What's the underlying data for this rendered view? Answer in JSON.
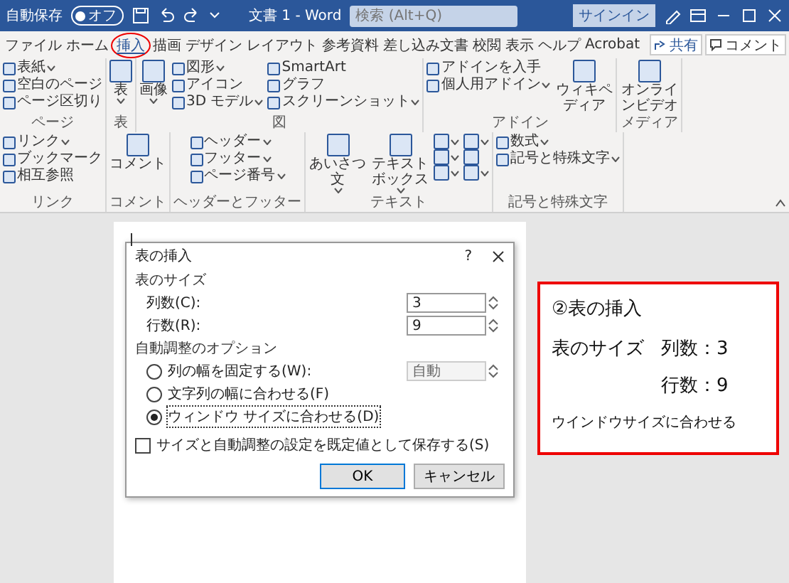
{
  "title_bar": {
    "autosave_label": "自動保存",
    "autosave_toggle": {
      "on": false,
      "label": "オフ"
    },
    "document_title": "文書 1 - Word",
    "search": {
      "placeholder": "検索 (Alt+Q)"
    },
    "sign_in": "サインイン"
  },
  "ribbon_tabs": [
    {
      "label": "ファイル",
      "selected": false,
      "circled": false
    },
    {
      "label": "ホーム",
      "selected": false,
      "circled": false
    },
    {
      "label": "挿入",
      "selected": true,
      "circled": true
    },
    {
      "label": "描画",
      "selected": false,
      "circled": false
    },
    {
      "label": "デザイン",
      "selected": false,
      "circled": false
    },
    {
      "label": "レイアウト",
      "selected": false,
      "circled": false
    },
    {
      "label": "参考資料",
      "selected": false,
      "circled": false
    },
    {
      "label": "差し込み文書",
      "selected": false,
      "circled": false
    },
    {
      "label": "校閲",
      "selected": false,
      "circled": false
    },
    {
      "label": "表示",
      "selected": false,
      "circled": false
    },
    {
      "label": "ヘルプ",
      "selected": false,
      "circled": false
    },
    {
      "label": "Acrobat",
      "selected": false,
      "circled": false
    }
  ],
  "share_button": "共有",
  "comment_button": "コメント",
  "ribbon_groups": [
    {
      "label": "ページ",
      "columns": [
        [
          {
            "kind": "small",
            "label": "表紙",
            "dropdown": true
          },
          {
            "kind": "small",
            "label": "空白のページ",
            "dropdown": false
          },
          {
            "kind": "small",
            "label": "ページ区切り",
            "dropdown": false
          }
        ]
      ]
    },
    {
      "label": "表",
      "columns": [
        [
          {
            "kind": "large",
            "label": "表",
            "dropdown": true
          }
        ]
      ]
    },
    {
      "label": "図",
      "columns": [
        [
          {
            "kind": "large",
            "label": "画像",
            "dropdown": true
          }
        ],
        [
          {
            "kind": "small",
            "label": "図形",
            "dropdown": true
          },
          {
            "kind": "small",
            "label": "アイコン",
            "dropdown": false
          },
          {
            "kind": "small",
            "label": "3D モデル",
            "dropdown": true
          }
        ],
        [
          {
            "kind": "small",
            "label": "SmartArt",
            "dropdown": false
          },
          {
            "kind": "small",
            "label": "グラフ",
            "dropdown": false
          },
          {
            "kind": "small",
            "label": "スクリーンショット",
            "dropdown": true
          }
        ]
      ]
    },
    {
      "label": "アドイン",
      "columns": [
        [
          {
            "kind": "small",
            "label": "アドインを入手",
            "dropdown": false
          },
          {
            "kind": "small",
            "label": "個人用アドイン",
            "dropdown": true
          }
        ],
        [
          {
            "kind": "large",
            "label": "ウィキペディア",
            "dropdown": false
          }
        ]
      ]
    },
    {
      "label": "メディア",
      "columns": [
        [
          {
            "kind": "large",
            "label": "オンラインビデオ",
            "dropdown": false
          }
        ]
      ]
    },
    {
      "label": "リンク",
      "columns": [
        [
          {
            "kind": "small",
            "label": "リンク",
            "dropdown": true
          },
          {
            "kind": "small",
            "label": "ブックマーク",
            "dropdown": false
          },
          {
            "kind": "small",
            "label": "相互参照",
            "dropdown": false
          }
        ]
      ]
    },
    {
      "label": "コメント",
      "columns": [
        [
          {
            "kind": "large",
            "label": "コメント",
            "dropdown": false
          }
        ]
      ]
    },
    {
      "label": "ヘッダーとフッター",
      "columns": [
        [
          {
            "kind": "small",
            "label": "ヘッダー",
            "dropdown": true
          },
          {
            "kind": "small",
            "label": "フッター",
            "dropdown": true
          },
          {
            "kind": "small",
            "label": "ページ番号",
            "dropdown": true
          }
        ]
      ]
    },
    {
      "label": "テキスト",
      "columns": [
        [
          {
            "kind": "large",
            "label": "あいさつ文",
            "dropdown": true
          }
        ],
        [
          {
            "kind": "large",
            "label": "テキストボックス",
            "dropdown": true
          }
        ],
        [
          {
            "kind": "icon",
            "dropdown": true
          },
          {
            "kind": "icon",
            "dropdown": true
          },
          {
            "kind": "icon",
            "dropdown": true
          }
        ],
        [
          {
            "kind": "icon",
            "dropdown": true
          },
          {
            "kind": "icon",
            "dropdown": false
          },
          {
            "kind": "icon",
            "dropdown": true
          }
        ]
      ]
    },
    {
      "label": "記号と特殊文字",
      "columns": [
        [
          {
            "kind": "small",
            "label": "数式",
            "dropdown": true
          },
          {
            "kind": "small",
            "label": "記号と特殊文字",
            "dropdown": true
          }
        ]
      ]
    }
  ],
  "dialog": {
    "title": "表の挿入",
    "help": "?",
    "size_heading": "表のサイズ",
    "size_fields": [
      {
        "label": "列数(C):",
        "value": "3"
      },
      {
        "label": "行数(R):",
        "value": "9"
      }
    ],
    "autofit_heading": "自動調整のオプション",
    "options": [
      {
        "label": "列の幅を固定する(W):",
        "selected": false,
        "field": {
          "value": "自動",
          "disabled": true
        }
      },
      {
        "label": "文字列の幅に合わせる(F)",
        "selected": false
      },
      {
        "label": "ウィンドウ サイズに合わせる(D)",
        "selected": true
      }
    ],
    "save_default": {
      "label": "サイズと自動調整の設定を既定値として保存する(S)",
      "checked": false
    },
    "buttons": [
      "OK",
      "キャンセル"
    ]
  },
  "callout": {
    "title": "②表の挿入",
    "size_label": "表のサイズ",
    "columns_text": "列数：3",
    "rows_text": "行数：9",
    "note": "ウインドウサイズに合わせる"
  }
}
